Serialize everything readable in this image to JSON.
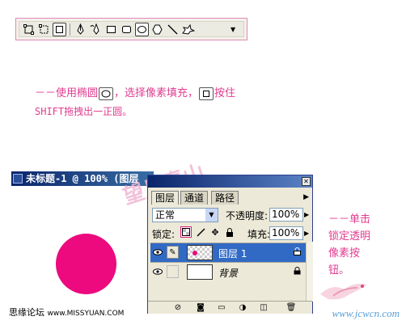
{
  "toolbar": {
    "tools": [
      {
        "name": "shape-layers-icon"
      },
      {
        "name": "paths-icon"
      },
      {
        "name": "fill-pixels-icon"
      },
      {
        "name": "pen-icon"
      },
      {
        "name": "freeform-pen-icon"
      },
      {
        "name": "rectangle-icon"
      },
      {
        "name": "rounded-rectangle-icon"
      },
      {
        "name": "ellipse-icon",
        "selected": true
      },
      {
        "name": "polygon-icon"
      },
      {
        "name": "line-icon"
      },
      {
        "name": "custom-shape-icon"
      },
      {
        "name": "dropdown-arrow-icon"
      }
    ]
  },
  "instruction": {
    "line1_a": "－－使用椭圆",
    "line1_b": "，选择像素填充，",
    "line1_c": "按住",
    "line2": "SHIFT拖拽出一正圆。"
  },
  "doc_window": {
    "title": "未标题-1 @ 100% (图层",
    "circle_color": "#ec0a7e"
  },
  "watermark": {
    "text": "望月青山"
  },
  "layers_panel": {
    "tabs": [
      "图层",
      "通道",
      "路径"
    ],
    "blend_mode": "正常",
    "opacity_label": "不透明度:",
    "opacity_value": "100%",
    "lock_label": "锁定:",
    "fill_label": "填充:",
    "fill_value": "100%",
    "layers": [
      {
        "name": "图层 1",
        "selected": true
      },
      {
        "name": "背景",
        "selected": false
      }
    ]
  },
  "side_note": {
    "lines": [
      "－－单击",
      "锁定透明",
      "像素按",
      "钮。"
    ]
  },
  "footer": {
    "left_label": "思缘论坛",
    "left_url": "www.MISSYUAN.COM",
    "right_text": "www.jcwcn.com"
  },
  "colors": {
    "accent_pink": "#e03c90",
    "selected_row": "#316ac5",
    "title_bar": "#0a246a"
  }
}
